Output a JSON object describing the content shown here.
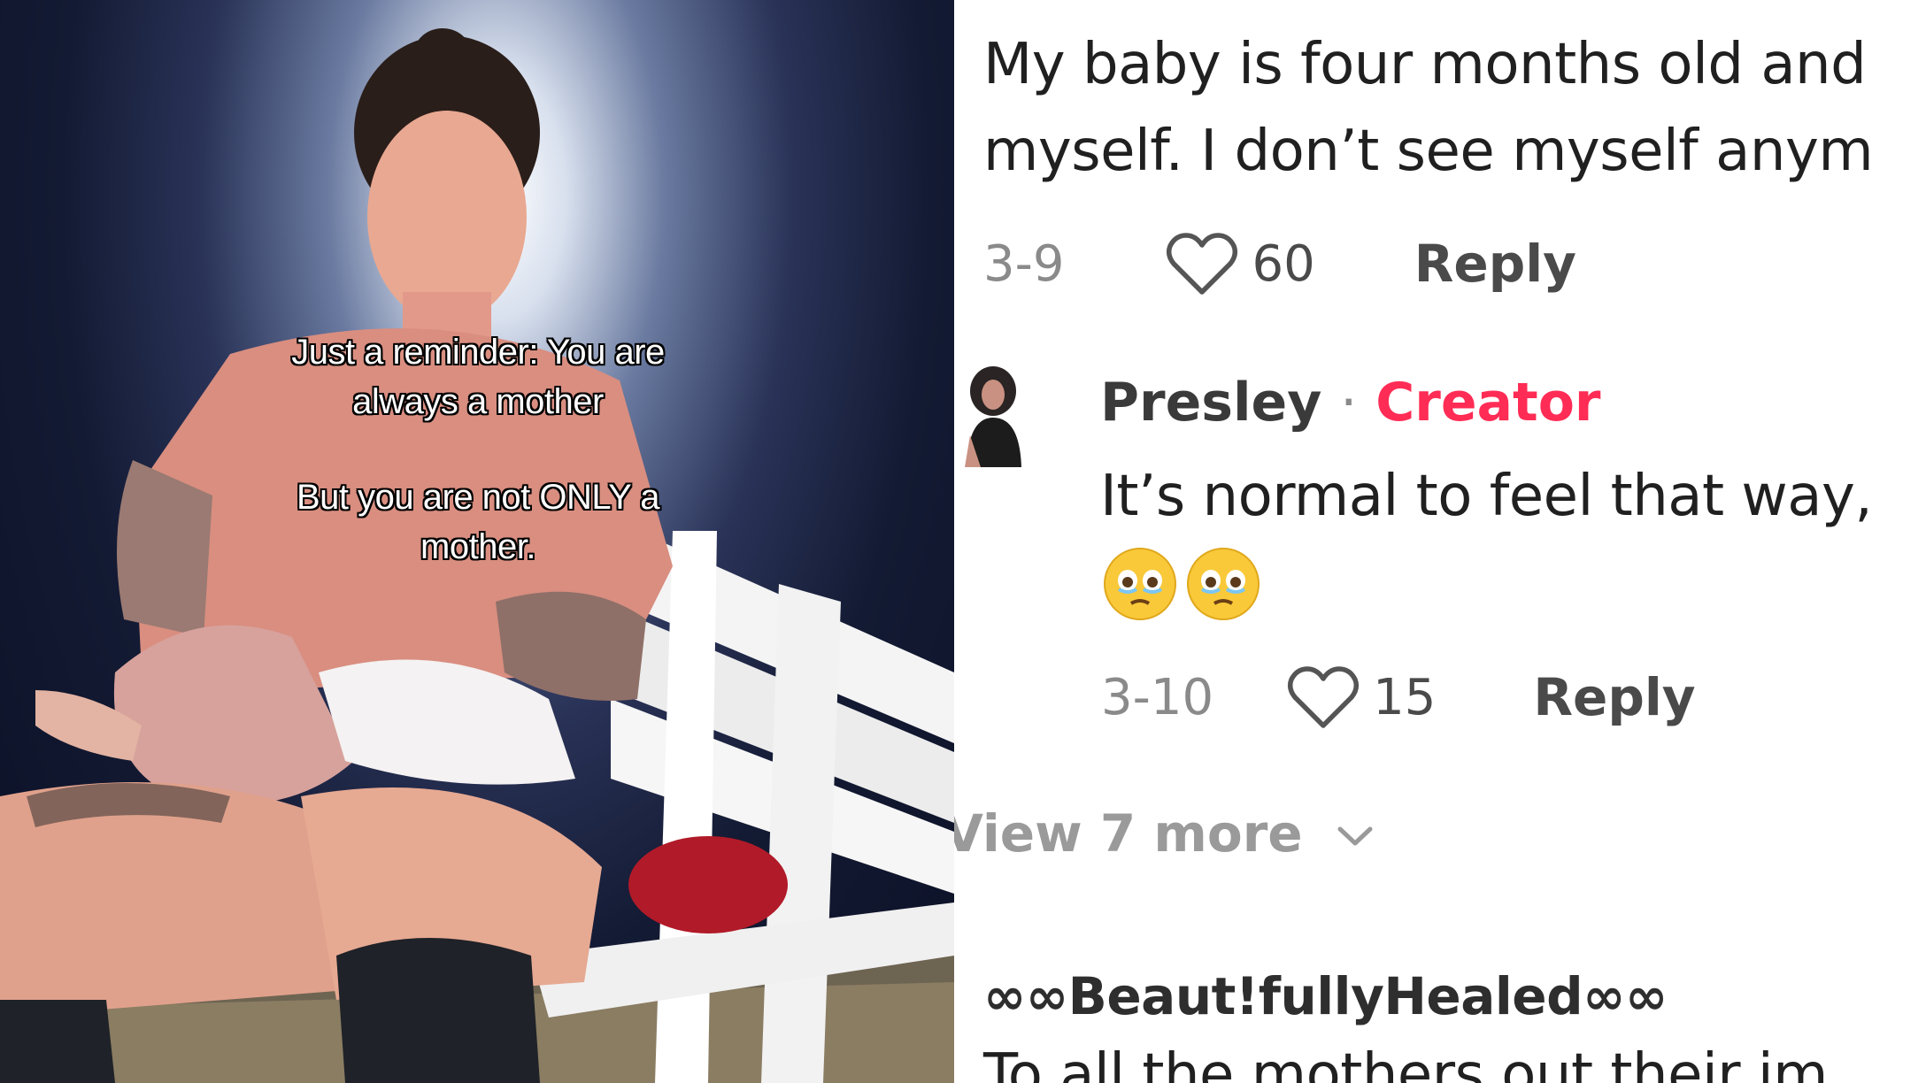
{
  "video": {
    "caption_line1": "Just a reminder: You are",
    "caption_line2": "always a mother",
    "caption_line3": "But you are not ONLY a",
    "caption_line4": "mother."
  },
  "comments": {
    "first": {
      "body_line1": "My baby is four months old and",
      "body_line2": "myself. I don’t see myself anym",
      "date": "3-9",
      "likes": "60",
      "reply_label": "Reply"
    },
    "reply": {
      "author": "Presley",
      "separator": "·",
      "badge": "Creator",
      "body_line1": "It’s normal to feel that way,",
      "emojis": [
        "face-holding-back-tears-icon",
        "face-holding-back-tears-icon"
      ],
      "date": "3-10",
      "likes": "15",
      "reply_label": "Reply"
    },
    "view_more": "View 7 more",
    "next": {
      "author": "∞∞Beaut!fullyHealed∞∞",
      "body_line1": "To all the mothers out their im"
    }
  },
  "colors": {
    "creator_badge": "#ff2c55",
    "meta_gray": "#8a8a8a",
    "text_dark": "#202020"
  }
}
